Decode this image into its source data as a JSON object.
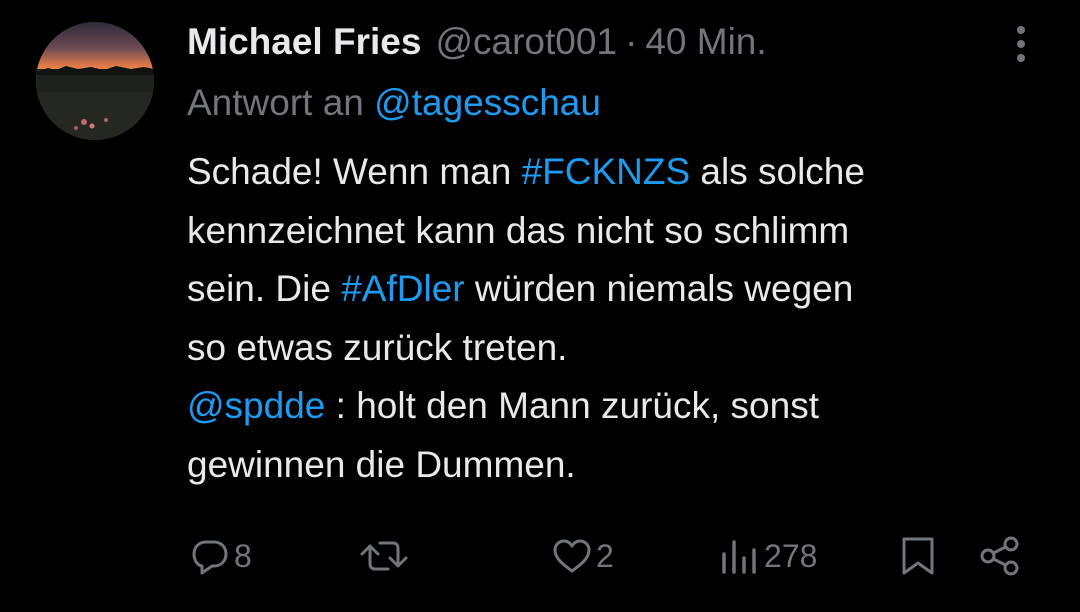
{
  "tweet": {
    "display_name": "Michael Fries",
    "handle": "@carot001",
    "separator": "·",
    "time": "40 Min.",
    "reply_prefix": "Antwort an",
    "reply_to": "@tagesschau",
    "body": {
      "line1_a": "Schade! Wenn man ",
      "line1_hashtag": "#FCKNZS",
      "line1_b": " als solche",
      "line2": "kennzeichnet kann das nicht so schlimm",
      "line3_a": "sein. Die ",
      "line3_hashtag": "#AfDler",
      "line3_b": " würden niemals wegen",
      "line4": "so etwas zurück treten.",
      "line5_mention": "@spdde",
      "line5_b": " : holt den Mann zurück, sonst",
      "line6": "gewinnen die Dummen."
    }
  },
  "actions": {
    "replies": "8",
    "retweets": "",
    "likes": "2",
    "views": "278"
  },
  "icons": {
    "more": "more-vertical-icon",
    "reply": "reply-icon",
    "retweet": "retweet-icon",
    "like": "heart-icon",
    "views": "views-icon",
    "bookmark": "bookmark-icon",
    "share": "share-icon"
  },
  "colors": {
    "background": "#000000",
    "text": "#e7e9ea",
    "secondary": "#71767b",
    "link": "#1d9bf0"
  }
}
